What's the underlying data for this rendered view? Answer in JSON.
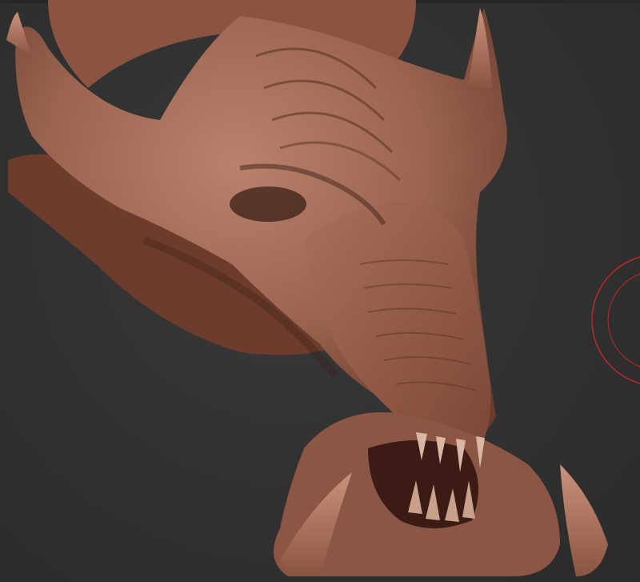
{
  "viewport": {
    "background_color": "#2f2f2f",
    "model_color": "#9a6450",
    "model_highlight": "#b9826c",
    "model_shadow": "#4a2a1f",
    "brush_cursor_color": "#c0282a"
  },
  "icons": {
    "brush_cursor": "brush-cursor-icon"
  }
}
